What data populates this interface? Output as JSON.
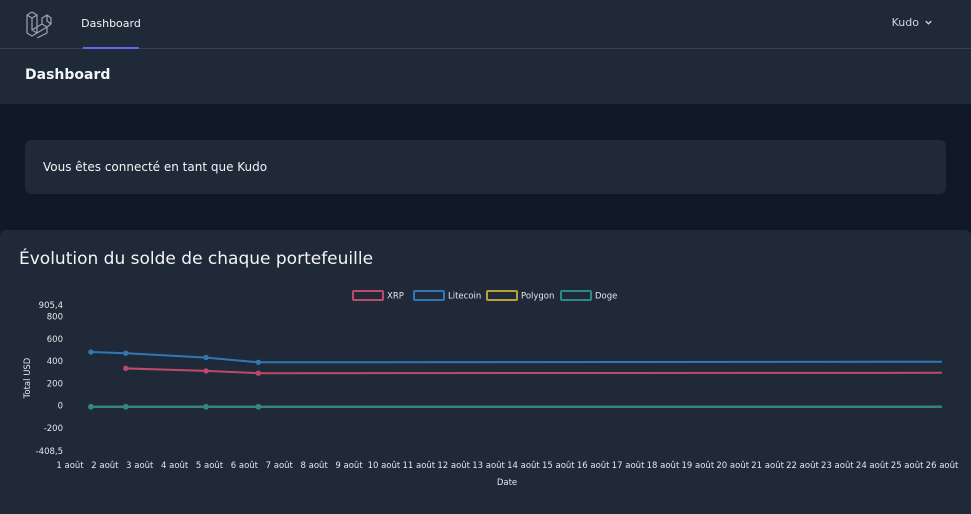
{
  "navbar": {
    "logo": "laravel-logo",
    "links": [
      {
        "label": "Dashboard",
        "active": true
      }
    ],
    "user_name": "Kudo",
    "dropdown_icon": "chevron-down-icon"
  },
  "header": {
    "title": "Dashboard"
  },
  "notice": {
    "text": "Vous êtes connecté en tant que Kudo"
  },
  "chart_card": {
    "title": "Évolution du solde de chaque portefeuille"
  },
  "colors": {
    "navbar_bg": "#1f2937",
    "page_bg": "#111827",
    "accent": "#6366f1"
  },
  "chart_data": {
    "type": "line",
    "title": "",
    "xlabel": "Date",
    "ylabel": "Total USD",
    "x": [
      "1 août",
      "2 août",
      "3 août",
      "4 août",
      "5 août",
      "6 août",
      "7 août",
      "8 août",
      "9 août",
      "10 août",
      "11 août",
      "12 août",
      "13 août",
      "14 août",
      "15 août",
      "16 août",
      "17 août",
      "18 août",
      "19 août",
      "20 août",
      "21 août",
      "22 août",
      "23 août",
      "24 août",
      "25 août",
      "26 août"
    ],
    "ylim": [
      -408.5,
      905.4
    ],
    "yticks": [
      {
        "value": 905.4,
        "label": "905,4"
      },
      {
        "value": 800,
        "label": "800"
      },
      {
        "value": 600,
        "label": "600"
      },
      {
        "value": 400,
        "label": "400"
      },
      {
        "value": 200,
        "label": "200"
      },
      {
        "value": 0,
        "label": "0"
      },
      {
        "value": -200,
        "label": "-200"
      },
      {
        "value": -408.5,
        "label": "-408,5"
      }
    ],
    "legend_position": "top",
    "grid": false,
    "series": [
      {
        "name": "XRP",
        "color": "#be4a6a",
        "points": [
          [
            2.6,
            335
          ],
          [
            4.9,
            312
          ],
          [
            6.4,
            292
          ],
          [
            26.0,
            295
          ]
        ]
      },
      {
        "name": "Litecoin",
        "color": "#2f78b5",
        "points": [
          [
            1.6,
            482
          ],
          [
            2.6,
            472
          ],
          [
            4.9,
            432
          ],
          [
            6.4,
            390
          ],
          [
            26.0,
            395
          ]
        ]
      },
      {
        "name": "Polygon",
        "color": "#b7a13b",
        "points": [
          [
            1.6,
            -10
          ],
          [
            2.6,
            -10
          ],
          [
            4.9,
            -10
          ],
          [
            6.4,
            -10
          ],
          [
            26.0,
            -10
          ]
        ]
      },
      {
        "name": "Doge",
        "color": "#2b8a86",
        "points": [
          [
            1.6,
            -12
          ],
          [
            2.6,
            -12
          ],
          [
            4.9,
            -12
          ],
          [
            6.4,
            -12
          ],
          [
            26.0,
            -12
          ]
        ]
      }
    ]
  }
}
